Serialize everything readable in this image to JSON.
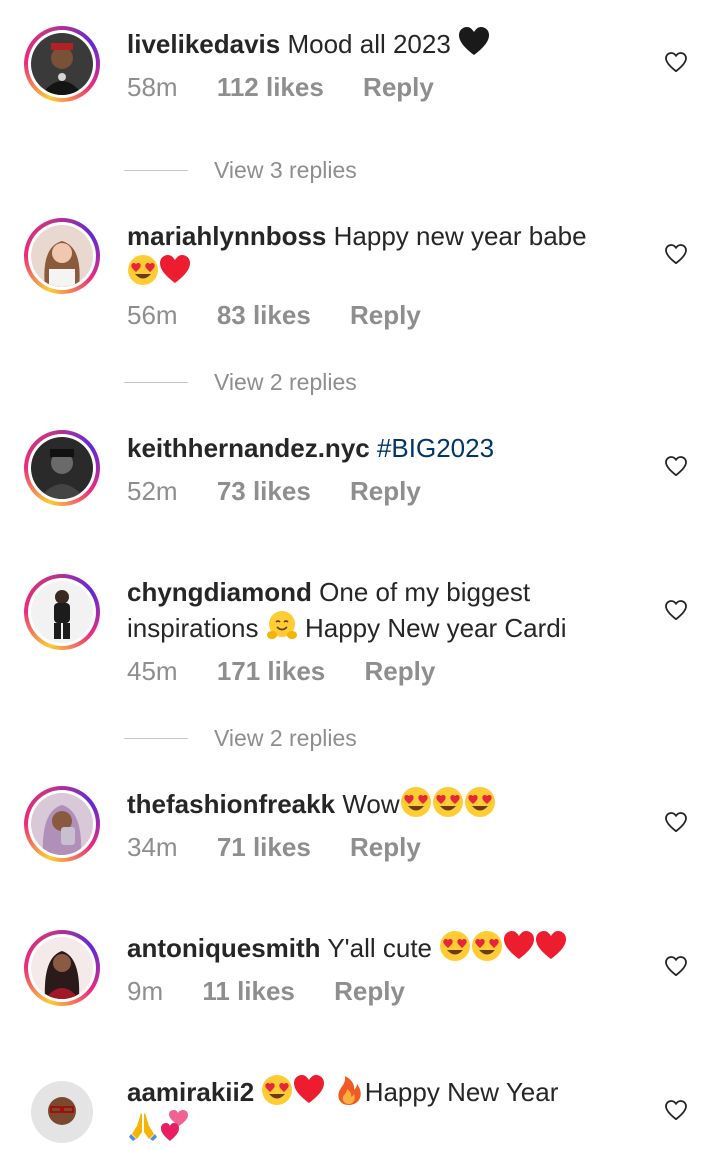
{
  "comments": [
    {
      "username": "livelikedavis",
      "text": "Mood all 2023",
      "emoji": "black-heart",
      "time": "58m",
      "likes": "112 likes",
      "reply": "Reply",
      "view_replies": "View 3 replies"
    },
    {
      "username": "mariahlynnboss",
      "text": "Happy new year babe",
      "emoji": "heart-eyes, red-heart",
      "time": "56m",
      "likes": "83 likes",
      "reply": "Reply",
      "view_replies": "View 2 replies"
    },
    {
      "username": "keithhernandez.nyc",
      "text": "#BIG2023",
      "time": "52m",
      "likes": "73 likes",
      "reply": "Reply"
    },
    {
      "username": "chyngdiamond",
      "text_line1": "One of my biggest",
      "text_line2a": "inspirations",
      "text_line2b": "Happy New year Cardi",
      "emoji": "hugging-face",
      "time": "45m",
      "likes": "171 likes",
      "reply": "Reply",
      "view_replies": "View 2 replies"
    },
    {
      "username": "thefashionfreakk",
      "text": "Wow",
      "emoji": "heart-eyes x3",
      "time": "34m",
      "likes": "71 likes",
      "reply": "Reply"
    },
    {
      "username": "antoniquesmith",
      "text": "Y'all cute",
      "emoji": "heart-eyes x2, red-heart x2",
      "time": "9m",
      "likes": "11 likes",
      "reply": "Reply"
    },
    {
      "username": "aamirakii2",
      "text": "Happy New Year",
      "emoji": "heart-eyes, red-heart, fire, folded-hands, two-hearts"
    }
  ],
  "colors": {
    "username": "#262626",
    "meta": "#8e8e8e",
    "hashtag": "#00376b",
    "heart_red": "#ed1c2e"
  },
  "icons": {
    "like": "heart-outline-icon"
  }
}
